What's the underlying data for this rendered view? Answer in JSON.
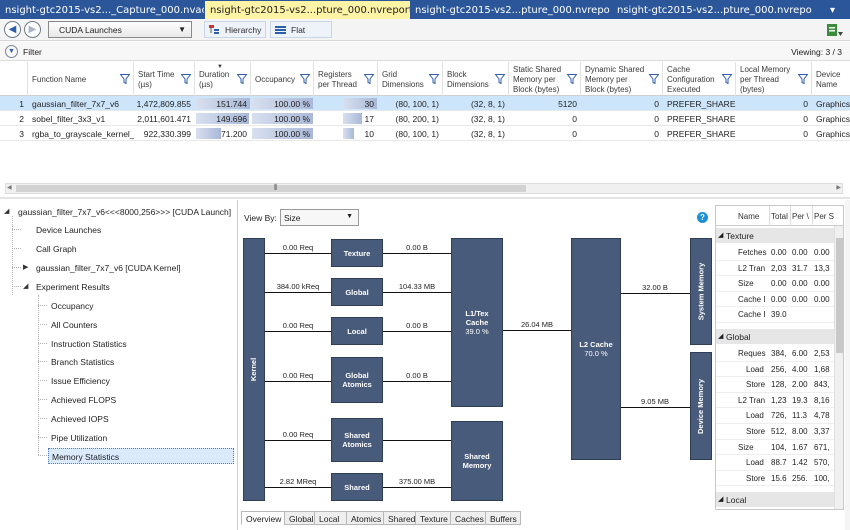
{
  "doc_tabs": [
    {
      "label": "nsight-gtc2015-vs2..._Capture_000.nvact*",
      "active": false
    },
    {
      "label": "nsight-gtc2015-vs2...pture_000.nvreport",
      "active": true,
      "pin": "⊸",
      "close": "✕"
    },
    {
      "label": "nsight-gtc2015-vs2...pture_000.nvreport",
      "active": false
    },
    {
      "label": "nsight-gtc2015-vs2...pture_000.nvreport",
      "active": false
    }
  ],
  "toolbar": {
    "launch_select": "CUDA Launches",
    "hierarchy_label": "Hierarchy",
    "flat_label": "Flat"
  },
  "filter": {
    "label": "Filter",
    "viewing": "Viewing: 3 / 3"
  },
  "table": {
    "columns": [
      "Function Name",
      "Start Time (µs)",
      "Duration (µs)",
      "Occupancy",
      "Registers per Thread",
      "Grid Dimensions",
      "Block Dimensions",
      "Static Shared Memory per Block (bytes)",
      "Dynamic Shared Memory per Block (bytes)",
      "Cache Configuration Executed",
      "Local Memory per Thread (bytes)",
      "Device Name"
    ],
    "rows": [
      {
        "idx": "1",
        "name": "gaussian_filter_7x7_v6",
        "start": "1,472,809.855",
        "duration": "151.744",
        "duration_frac": 1.0,
        "occupancy": "100.00 %",
        "occupancy_frac": 1.0,
        "registers": "30",
        "registers_frac": 1.0,
        "grid": "(80, 100, 1)",
        "block": "(32, 8, 1)",
        "static_shared": "5120",
        "dynamic_shared": "0",
        "cache": "PREFER_SHARED",
        "local_mem": "0",
        "device": "Graphics"
      },
      {
        "idx": "2",
        "name": "sobel_filter_3x3_v1",
        "start": "2,011,601.471",
        "duration": "149.696",
        "duration_frac": 0.986,
        "occupancy": "100.00 %",
        "occupancy_frac": 1.0,
        "registers": "17",
        "registers_frac": 0.57,
        "grid": "(80, 200, 1)",
        "block": "(32, 8, 1)",
        "static_shared": "0",
        "dynamic_shared": "0",
        "cache": "PREFER_SHARED",
        "local_mem": "0",
        "device": "Graphics"
      },
      {
        "idx": "3",
        "name": "rgba_to_grayscale_kernel_v1",
        "start": "922,330.399",
        "duration": "71.200",
        "duration_frac": 0.47,
        "occupancy": "100.00 %",
        "occupancy_frac": 1.0,
        "registers": "10",
        "registers_frac": 0.33,
        "grid": "(80, 100, 1)",
        "block": "(32, 8, 1)",
        "static_shared": "0",
        "dynamic_shared": "0",
        "cache": "PREFER_SHARED",
        "local_mem": "0",
        "device": "Graphics"
      }
    ]
  },
  "tree": {
    "root": "gaussian_filter_7x7_v6<<<8000,256>>> [CUDA Launch]",
    "device_launches": "Device Launches",
    "call_graph": "Call Graph",
    "kernel": "gaussian_filter_7x7_v6 [CUDA Kernel]",
    "experiment_results": "Experiment Results",
    "experiments": [
      "Occupancy",
      "All Counters",
      "Instruction Statistics",
      "Branch Statistics",
      "Issue Efficiency",
      "Achieved FLOPS",
      "Achieved IOPS",
      "Pipe Utilization",
      "Memory Statistics"
    ],
    "selected": "Memory Statistics"
  },
  "pane": {
    "view_by_label": "View By:",
    "view_by_value": "Size",
    "help": "?",
    "diagram": {
      "kernel": "Kernel",
      "texture": "Texture",
      "global": "Global",
      "local": "Local",
      "global_atomics": "Global Atomics",
      "shared_atomics": "Shared Atomics",
      "shared": "Shared",
      "l1_title": "L1/Tex Cache",
      "l1_pct": "39.0 %",
      "shared_memory": "Shared Memory",
      "l2_title": "L2 Cache",
      "l2_pct": "70.0 %",
      "system_memory": "System Memory",
      "device_memory": "Device Memory",
      "req_texture": "0.00 Req",
      "req_global": "384.00 kReq",
      "req_local": "0.00 Req",
      "req_global_atomics": "0.00 Req",
      "req_shared_atomics": "0.00 Req",
      "req_shared": "2.82 MReq",
      "b_texture": "0.00 B",
      "b_global": "104.33 MB",
      "b_local": "0.00 B",
      "b_global_atomics": "0.00 B",
      "b_shared": "375.00 MB",
      "b_l1_l2": "26.04 MB",
      "b_l2_system": "32.00 B",
      "b_l2_device": "9.05 MB"
    },
    "bottom_tabs": [
      "Overview",
      "Global",
      "Local",
      "Atomics",
      "Shared",
      "Texture",
      "Caches",
      "Buffers"
    ],
    "active_tab": "Overview"
  },
  "stats": {
    "columns": [
      "Name",
      "Total",
      "Per Warp",
      "Per Second"
    ],
    "col_shown": [
      "Name",
      "Total",
      "Per \\",
      "Per S"
    ],
    "groups": [
      {
        "name": "Texture",
        "rows": [
          [
            "Fetches",
            "0.00",
            "0.00",
            "0.00"
          ],
          [
            "L2 Tran",
            "2,03",
            "31.7",
            "13,3"
          ],
          [
            "Size",
            "0.00",
            "0.00",
            "0.00"
          ],
          [
            "Cache I",
            "0.00",
            "0.00",
            "0.00"
          ],
          [
            "Cache I",
            "39.0",
            "",
            ""
          ]
        ]
      },
      {
        "name": "Global",
        "rows": [
          [
            "Reques",
            "384,",
            "6.00",
            "2,53"
          ],
          [
            "Load",
            "256,",
            "4.00",
            "1,68"
          ],
          [
            "Store",
            "128,",
            "2.00",
            "843,"
          ],
          [
            "L2 Tran",
            "1,23",
            "19.3",
            "8,16"
          ],
          [
            "Load",
            "726,",
            "11.3",
            "4,78"
          ],
          [
            "Store",
            "512,",
            "8.00",
            "3,37"
          ],
          [
            "Size",
            "104,",
            "1.67",
            "671,"
          ],
          [
            "Load",
            "88.7",
            "1.42",
            "570,"
          ],
          [
            "Store",
            "15.6",
            "256.",
            "100,"
          ]
        ]
      },
      {
        "name": "Local",
        "rows": []
      }
    ]
  },
  "colors": {
    "tab_strip": "#2b579a",
    "active_tab": "#fff3a6",
    "block": "#485b7a",
    "duration_bar": "#a9b8d8",
    "occupancy_bar": "#a9b8d8",
    "selected_row": "#cde5fb"
  }
}
